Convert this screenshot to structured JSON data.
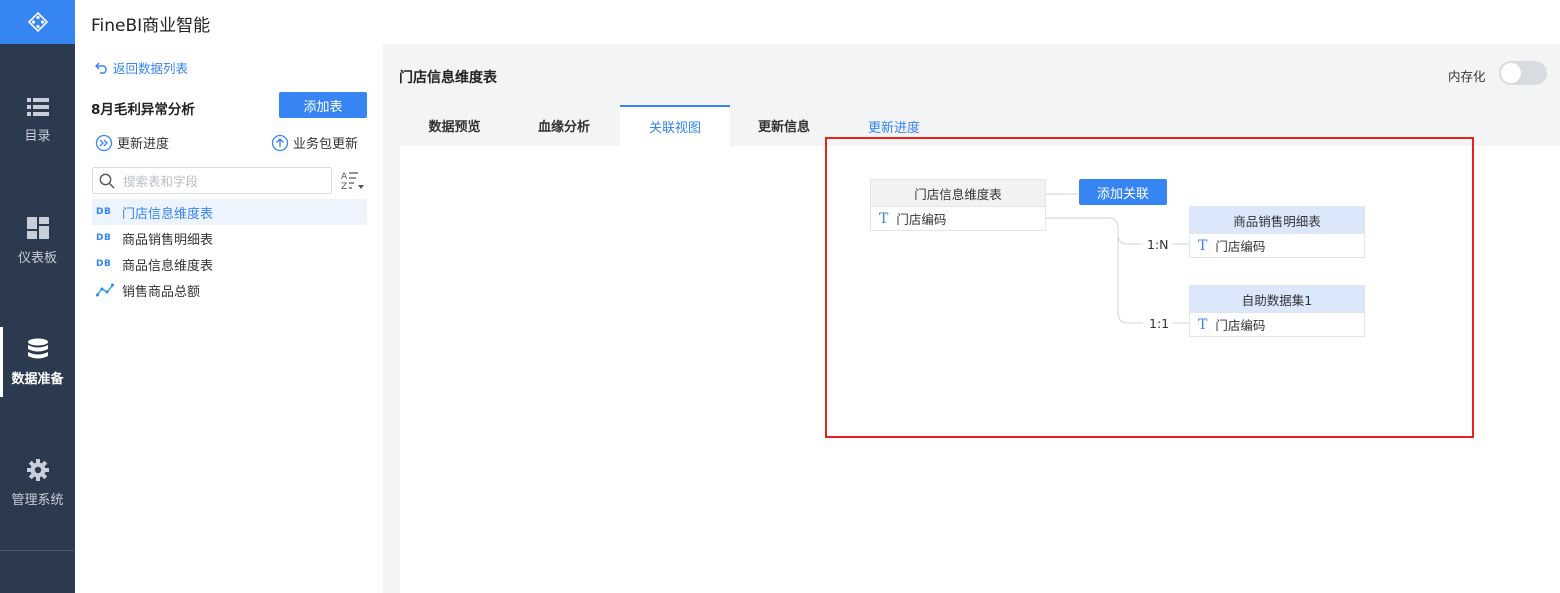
{
  "app": {
    "title": "FineBI商业智能"
  },
  "nav": {
    "items": [
      {
        "label": "目录",
        "icon": "list-icon"
      },
      {
        "label": "仪表板",
        "icon": "dashboard-icon"
      },
      {
        "label": "数据准备",
        "icon": "database-icon",
        "active": true
      },
      {
        "label": "管理系统",
        "icon": "gear-icon"
      }
    ]
  },
  "panel": {
    "back_label": "返回数据列表",
    "package_title": "8月毛利异常分析",
    "add_table_label": "添加表",
    "update_progress_label": "更新进度",
    "package_update_label": "业务包更新",
    "search_placeholder": "搜索表和字段",
    "tables": [
      {
        "label": "门店信息维度表",
        "badge": "DB",
        "selected": true
      },
      {
        "label": "商品销售明细表",
        "badge": "DB"
      },
      {
        "label": "商品信息维度表",
        "badge": "DB"
      },
      {
        "label": "销售商品总额",
        "badge": ""
      }
    ]
  },
  "main": {
    "title": "门店信息维度表",
    "toggle_label": "内存化",
    "toggle_on": false,
    "tabs": [
      "数据预览",
      "血缘分析",
      "关联视图",
      "更新信息"
    ],
    "active_tab": "关联视图",
    "update_progress_link": "更新进度"
  },
  "relation": {
    "add_relation_label": "添加关联",
    "source": {
      "name": "门店信息维度表",
      "field": "门店编码"
    },
    "targets": [
      {
        "name": "商品销售明细表",
        "field": "门店编码",
        "cardinality": "1:N"
      },
      {
        "name": "自助数据集1",
        "field": "门店编码",
        "cardinality": "1:1"
      }
    ]
  },
  "colors": {
    "accent": "#3685f2",
    "nav_bg": "#2c3a4f",
    "highlight": "#e8231e"
  }
}
